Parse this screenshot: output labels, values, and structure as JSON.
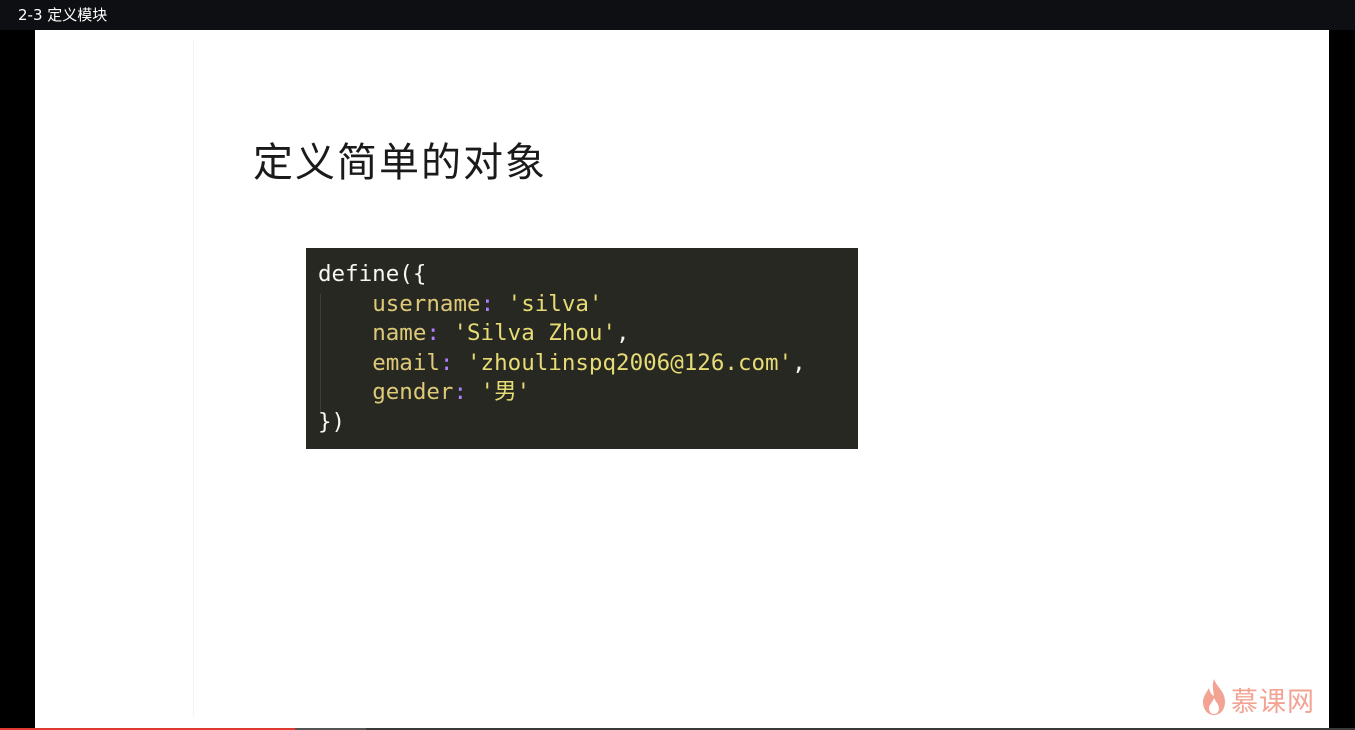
{
  "window": {
    "title": "2-3 定义模块"
  },
  "slide": {
    "title": "定义简单的对象",
    "code": {
      "open": "define({",
      "fields": [
        {
          "key": "username",
          "colon": ":",
          "value": " 'silva'",
          "trail": ""
        },
        {
          "key": "name",
          "colon": ":",
          "value": " 'Silva Zhou'",
          "trail": ","
        },
        {
          "key": "email",
          "colon": ":",
          "value": " 'zhoulinspq2006@126.com'",
          "trail": ","
        },
        {
          "key": "gender",
          "colon": ":",
          "value": " '男'",
          "trail": ""
        }
      ],
      "close": "})"
    }
  },
  "watermark": {
    "text": "慕课网",
    "icon": "flame-icon",
    "color": "#e8593c"
  },
  "player": {
    "progress_fraction": 0.218,
    "buffer_fraction": 0.27,
    "accent": "#e03a2f"
  }
}
